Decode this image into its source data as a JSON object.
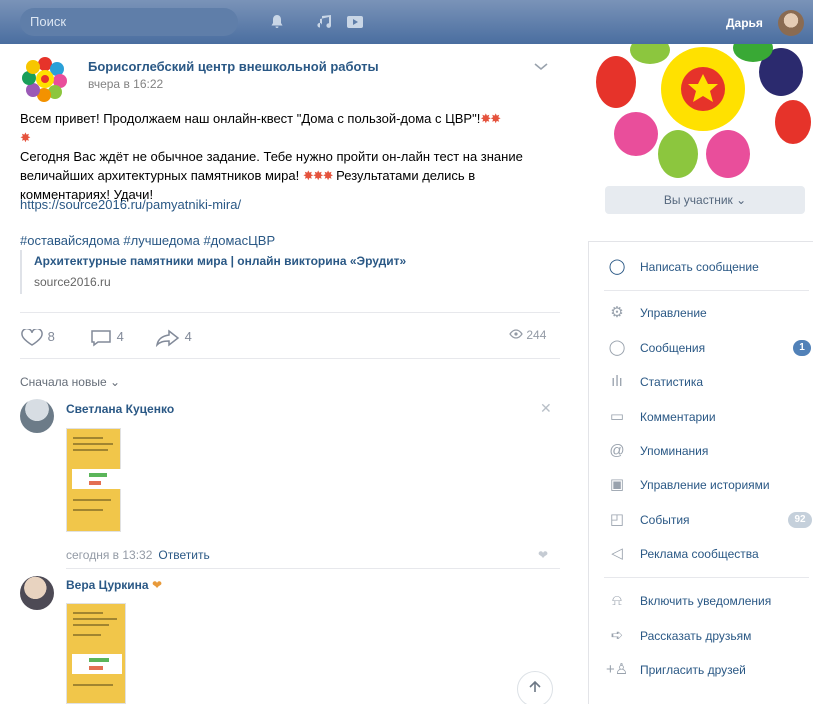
{
  "topbar": {
    "search_placeholder": "Поиск",
    "icons": [
      "bell-icon",
      "music-icon",
      "play-icon"
    ],
    "user_name": "Дарья"
  },
  "post": {
    "author": "Борисоглебский центр внешкольной работы",
    "time": "вчера в 16:22",
    "text_line1": "Всем привет! Продолжаем наш онлайн-квест \"Дома с пользой-дома с ЦВР\"!",
    "text_line2": "Сегодня Вас ждёт не обычное задание. Тебе нужно пройти он-лайн тест на знание величайших архитектурных памятников мира!",
    "text_line2b": "Результатами делись в комментариях! Удачи!",
    "link": "https://source2016.ru/pamyatniki-mira/",
    "tags": "#оставайсядома #лучшедома #домасЦВР",
    "attachment_title": "Архитектурные памятники мира | онлайн викторина «Эрудит»",
    "attachment_domain": "source2016.ru",
    "likes": "8",
    "comments": "4",
    "shares": "4",
    "views": "244",
    "sort_label": "Сначала новые"
  },
  "comments": [
    {
      "name": "Светлана Куценко",
      "time": "сегодня в 13:32",
      "reply": "Ответить"
    },
    {
      "name": "Вера Цуркина"
    }
  ],
  "sidebar": {
    "member_button": "Вы участник",
    "write_message": "Написать сообщение",
    "items": [
      {
        "label": "Управление",
        "icon": "gear-icon"
      },
      {
        "label": "Сообщения",
        "icon": "chat-icon",
        "badge": "1"
      },
      {
        "label": "Статистика",
        "icon": "stats-icon"
      },
      {
        "label": "Комментарии",
        "icon": "comment-icon"
      },
      {
        "label": "Упоминания",
        "icon": "at-icon"
      },
      {
        "label": "Управление историями",
        "icon": "stories-icon"
      },
      {
        "label": "События",
        "icon": "events-icon",
        "badge": "92"
      },
      {
        "label": "Реклама сообщества",
        "icon": "megaphone-icon"
      }
    ],
    "actions": [
      {
        "label": "Включить уведомления",
        "icon": "bell-icon"
      },
      {
        "label": "Рассказать друзьям",
        "icon": "share-icon"
      },
      {
        "label": "Пригласить друзей",
        "icon": "add-user-icon"
      }
    ]
  },
  "colors": {
    "topbar": "#4a6ea0",
    "link": "#2a5885",
    "badge": "#5181b8"
  }
}
